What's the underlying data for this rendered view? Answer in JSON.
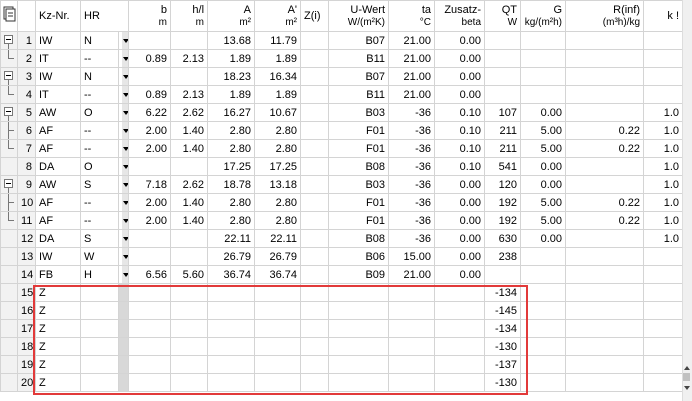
{
  "headers": [
    {
      "key": "kz",
      "top": "Kz-Nr.",
      "unit": ""
    },
    {
      "key": "hr",
      "top": "HR",
      "unit": ""
    },
    {
      "key": "b",
      "top": "b",
      "unit": "m"
    },
    {
      "key": "h",
      "top": "h/l",
      "unit": "m"
    },
    {
      "key": "a",
      "top": "A",
      "unit": "m²"
    },
    {
      "key": "a2",
      "top": "A'",
      "unit": "m²"
    },
    {
      "key": "zi",
      "top": "Z(i)",
      "unit": ""
    },
    {
      "key": "uwert",
      "top": "U-Wert",
      "unit": "W/(m²K)"
    },
    {
      "key": "ta",
      "top": "ta",
      "unit": "°C"
    },
    {
      "key": "zus",
      "top": "Zusatz-",
      "unit": "beta"
    },
    {
      "key": "qt",
      "top": "QT",
      "unit": "W"
    },
    {
      "key": "g",
      "top": "G",
      "unit": "kg/(m²h)"
    },
    {
      "key": "rinf",
      "top": "R(inf)",
      "unit": "(m³h)/kg"
    },
    {
      "key": "k",
      "top": "k",
      "unit": ""
    },
    {
      "key": "ex",
      "top": "!",
      "unit": ""
    }
  ],
  "rows": [
    {
      "n": "1",
      "kz": "IW",
      "hr": "N",
      "b": "",
      "h": "",
      "a": "13.68",
      "a2": "11.79",
      "zi": "",
      "uwert": "B07",
      "ta": "21.00",
      "zus": "0.00",
      "qt": "",
      "g": "",
      "rinf": "",
      "k": "",
      "ex": ""
    },
    {
      "n": "2",
      "kz": "IT",
      "hr": "--",
      "b": "0.89",
      "h": "2.13",
      "a": "1.89",
      "a2": "1.89",
      "zi": "",
      "uwert": "B11",
      "ta": "21.00",
      "zus": "0.00",
      "qt": "",
      "g": "",
      "rinf": "",
      "k": "",
      "ex": ""
    },
    {
      "n": "3",
      "kz": "IW",
      "hr": "N",
      "b": "",
      "h": "",
      "a": "18.23",
      "a2": "16.34",
      "zi": "",
      "uwert": "B07",
      "ta": "21.00",
      "zus": "0.00",
      "qt": "",
      "g": "",
      "rinf": "",
      "k": "",
      "ex": ""
    },
    {
      "n": "4",
      "kz": "IT",
      "hr": "--",
      "b": "0.89",
      "h": "2.13",
      "a": "1.89",
      "a2": "1.89",
      "zi": "",
      "uwert": "B11",
      "ta": "21.00",
      "zus": "0.00",
      "qt": "",
      "g": "",
      "rinf": "",
      "k": "",
      "ex": ""
    },
    {
      "n": "5",
      "kz": "AW",
      "hr": "O",
      "b": "6.22",
      "h": "2.62",
      "a": "16.27",
      "a2": "10.67",
      "zi": "",
      "uwert": "B03",
      "ta": "-36",
      "zus": "0.10",
      "qt": "107",
      "g": "0.00",
      "rinf": "",
      "k": "1.0",
      "ex": ""
    },
    {
      "n": "6",
      "kz": "AF",
      "hr": "--",
      "b": "2.00",
      "h": "1.40",
      "a": "2.80",
      "a2": "2.80",
      "zi": "",
      "uwert": "F01",
      "ta": "-36",
      "zus": "0.10",
      "qt": "211",
      "g": "5.00",
      "rinf": "0.22",
      "k": "1.0",
      "ex": ""
    },
    {
      "n": "7",
      "kz": "AF",
      "hr": "--",
      "b": "2.00",
      "h": "1.40",
      "a": "2.80",
      "a2": "2.80",
      "zi": "",
      "uwert": "F01",
      "ta": "-36",
      "zus": "0.10",
      "qt": "211",
      "g": "5.00",
      "rinf": "0.22",
      "k": "1.0",
      "ex": ""
    },
    {
      "n": "8",
      "kz": "DA",
      "hr": "O",
      "b": "",
      "h": "",
      "a": "17.25",
      "a2": "17.25",
      "zi": "",
      "uwert": "B08",
      "ta": "-36",
      "zus": "0.10",
      "qt": "541",
      "g": "0.00",
      "rinf": "",
      "k": "1.0",
      "ex": ""
    },
    {
      "n": "9",
      "kz": "AW",
      "hr": "S",
      "b": "7.18",
      "h": "2.62",
      "a": "18.78",
      "a2": "13.18",
      "zi": "",
      "uwert": "B03",
      "ta": "-36",
      "zus": "0.00",
      "qt": "120",
      "g": "0.00",
      "rinf": "",
      "k": "1.0",
      "ex": ""
    },
    {
      "n": "10",
      "kz": "AF",
      "hr": "--",
      "b": "2.00",
      "h": "1.40",
      "a": "2.80",
      "a2": "2.80",
      "zi": "",
      "uwert": "F01",
      "ta": "-36",
      "zus": "0.00",
      "qt": "192",
      "g": "5.00",
      "rinf": "0.22",
      "k": "1.0",
      "ex": ""
    },
    {
      "n": "11",
      "kz": "AF",
      "hr": "--",
      "b": "2.00",
      "h": "1.40",
      "a": "2.80",
      "a2": "2.80",
      "zi": "",
      "uwert": "F01",
      "ta": "-36",
      "zus": "0.00",
      "qt": "192",
      "g": "5.00",
      "rinf": "0.22",
      "k": "1.0",
      "ex": ""
    },
    {
      "n": "12",
      "kz": "DA",
      "hr": "S",
      "b": "",
      "h": "",
      "a": "22.11",
      "a2": "22.11",
      "zi": "",
      "uwert": "B08",
      "ta": "-36",
      "zus": "0.00",
      "qt": "630",
      "g": "0.00",
      "rinf": "",
      "k": "1.0",
      "ex": ""
    },
    {
      "n": "13",
      "kz": "IW",
      "hr": "W",
      "b": "",
      "h": "",
      "a": "26.79",
      "a2": "26.79",
      "zi": "",
      "uwert": "B06",
      "ta": "15.00",
      "zus": "0.00",
      "qt": "238",
      "g": "",
      "rinf": "",
      "k": "",
      "ex": ""
    },
    {
      "n": "14",
      "kz": "FB",
      "hr": "H",
      "b": "6.56",
      "h": "5.60",
      "a": "36.74",
      "a2": "36.74",
      "zi": "",
      "uwert": "B09",
      "ta": "21.00",
      "zus": "0.00",
      "qt": "",
      "g": "",
      "rinf": "",
      "k": "",
      "ex": ""
    },
    {
      "n": "15",
      "kz": "Z",
      "hr": "",
      "b": "",
      "h": "",
      "a": "",
      "a2": "",
      "zi": "",
      "uwert": "",
      "ta": "",
      "zus": "",
      "qt": "-134",
      "g": "",
      "rinf": "",
      "k": "",
      "ex": ""
    },
    {
      "n": "16",
      "kz": "Z",
      "hr": "",
      "b": "",
      "h": "",
      "a": "",
      "a2": "",
      "zi": "",
      "uwert": "",
      "ta": "",
      "zus": "",
      "qt": "-145",
      "g": "",
      "rinf": "",
      "k": "",
      "ex": ""
    },
    {
      "n": "17",
      "kz": "Z",
      "hr": "",
      "b": "",
      "h": "",
      "a": "",
      "a2": "",
      "zi": "",
      "uwert": "",
      "ta": "",
      "zus": "",
      "qt": "-134",
      "g": "",
      "rinf": "",
      "k": "",
      "ex": ""
    },
    {
      "n": "18",
      "kz": "Z",
      "hr": "",
      "b": "",
      "h": "",
      "a": "",
      "a2": "",
      "zi": "",
      "uwert": "",
      "ta": "",
      "zus": "",
      "qt": "-130",
      "g": "",
      "rinf": "",
      "k": "",
      "ex": ""
    },
    {
      "n": "19",
      "kz": "Z",
      "hr": "",
      "b": "",
      "h": "",
      "a": "",
      "a2": "",
      "zi": "",
      "uwert": "",
      "ta": "",
      "zus": "",
      "qt": "-137",
      "g": "",
      "rinf": "",
      "k": "",
      "ex": ""
    },
    {
      "n": "20",
      "kz": "Z",
      "hr": "",
      "b": "",
      "h": "",
      "a": "",
      "a2": "",
      "zi": "",
      "uwert": "",
      "ta": "",
      "zus": "",
      "qt": "-130",
      "g": "",
      "rinf": "",
      "k": "",
      "ex": ""
    }
  ],
  "colors": {
    "highlight": "#e23a3a",
    "rowhead": "#f2f2f2",
    "gridline": "#d4d4d4"
  }
}
